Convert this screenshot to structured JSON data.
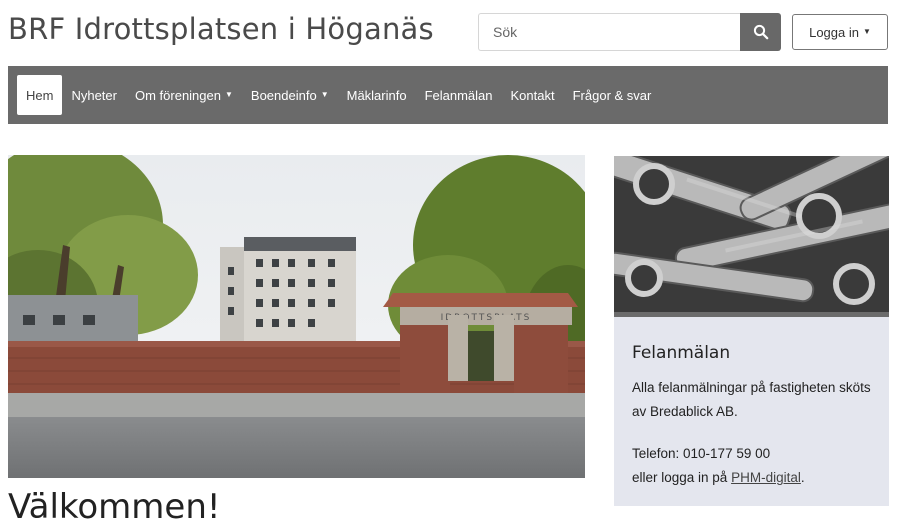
{
  "header": {
    "site_title": "BRF Idrottsplatsen i Höganäs",
    "search_placeholder": "Sök",
    "search_icon": "search-icon",
    "login_label": "Logga in"
  },
  "nav": {
    "items": [
      {
        "label": "Hem",
        "active": true,
        "dropdown": false
      },
      {
        "label": "Nyheter",
        "active": false,
        "dropdown": false
      },
      {
        "label": "Om föreningen",
        "active": false,
        "dropdown": true
      },
      {
        "label": "Boendeinfo",
        "active": false,
        "dropdown": true
      },
      {
        "label": "Mäklarinfo",
        "active": false,
        "dropdown": false
      },
      {
        "label": "Felanmälan",
        "active": false,
        "dropdown": false
      },
      {
        "label": "Kontakt",
        "active": false,
        "dropdown": false
      },
      {
        "label": "Frågor & svar",
        "active": false,
        "dropdown": false
      }
    ]
  },
  "hero": {
    "gate_sign": "IDROTTSPLATS"
  },
  "main": {
    "heading_partial": "Välkommen!"
  },
  "sidebar": {
    "card_title": "Felanmälan",
    "card_text": "Alla felanmälningar på fastigheten sköts av Bredablick AB.",
    "phone_line": "Telefon: 010-177 59 00",
    "login_prefix": "eller logga in på ",
    "link_text": "PHM-digital",
    "link_suffix": "."
  },
  "colors": {
    "navbar": "#6a6a6a",
    "search_button": "#686868",
    "card_bg": "#e4e6ee"
  }
}
